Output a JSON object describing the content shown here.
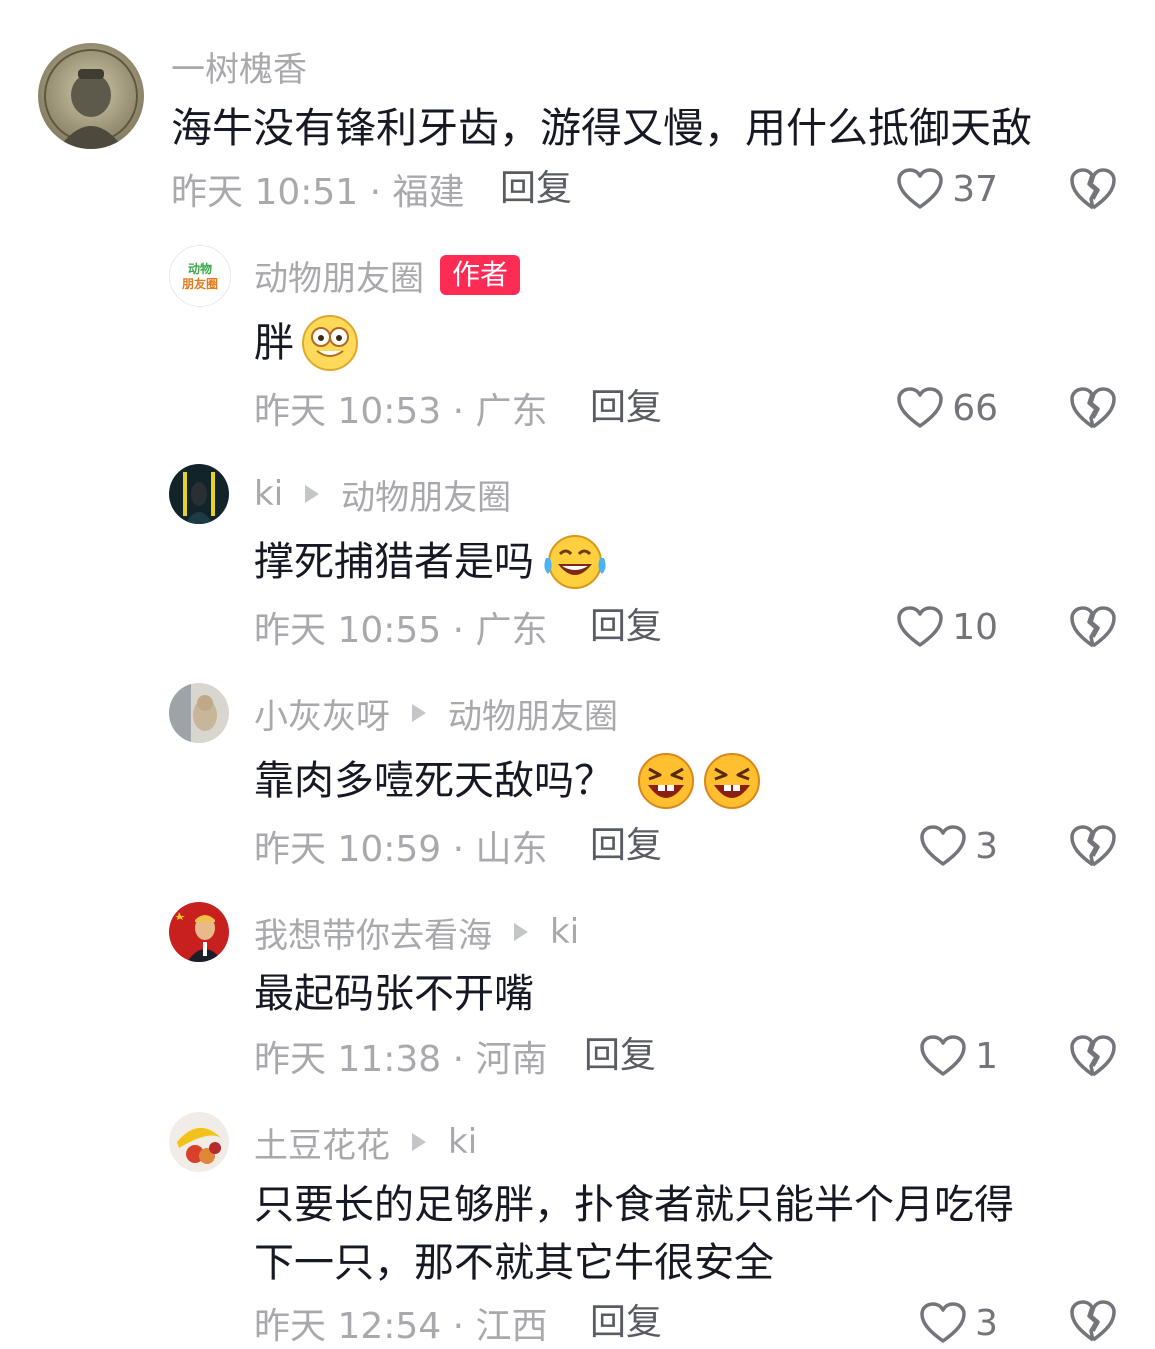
{
  "comments": [
    {
      "name": "一树槐香",
      "reply_to": "",
      "text": "海牛没有锋利牙齿，游得又慢，用什么抵御天敌",
      "meta": "昨天 10:51 · 福建",
      "reply_label": "回复",
      "likes": "37"
    },
    {
      "name": "动物朋友圈",
      "badge": "作者",
      "avatar_text": "动物朋友圈",
      "text": "胖",
      "meta": "昨天 10:53 · 广东",
      "reply_label": "回复",
      "likes": "66"
    },
    {
      "name": "ki",
      "reply_to": "动物朋友圈",
      "text": "撑死捕猎者是吗",
      "meta": "昨天 10:55 · 广东",
      "reply_label": "回复",
      "likes": "10"
    },
    {
      "name": "小灰灰呀",
      "reply_to": "动物朋友圈",
      "text": "靠肉多噎死天敌吗？",
      "meta": "昨天 10:59 · 山东",
      "reply_label": "回复",
      "likes": "3"
    },
    {
      "name": "我想带你去看海",
      "reply_to": "ki",
      "text": "最起码张不开嘴",
      "meta": "昨天 11:38 · 河南",
      "reply_label": "回复",
      "likes": "1"
    },
    {
      "name": "土豆花花",
      "reply_to": "ki",
      "text_line1": "只要长的足够胖，扑食者就只能半个月吃得",
      "text_line2": "下一只，那不就其它牛很安全",
      "meta": "昨天 12:54 · 江西",
      "reply_label": "回复",
      "likes": "3"
    }
  ],
  "icons": {
    "like": "heart-outline-icon",
    "dislike": "broken-heart-icon",
    "reply_arrow": "triangle-arrow-icon"
  },
  "colors": {
    "author_badge": "#fe2c55",
    "secondary_text": "#a8a9ad",
    "primary_text": "#161823"
  }
}
